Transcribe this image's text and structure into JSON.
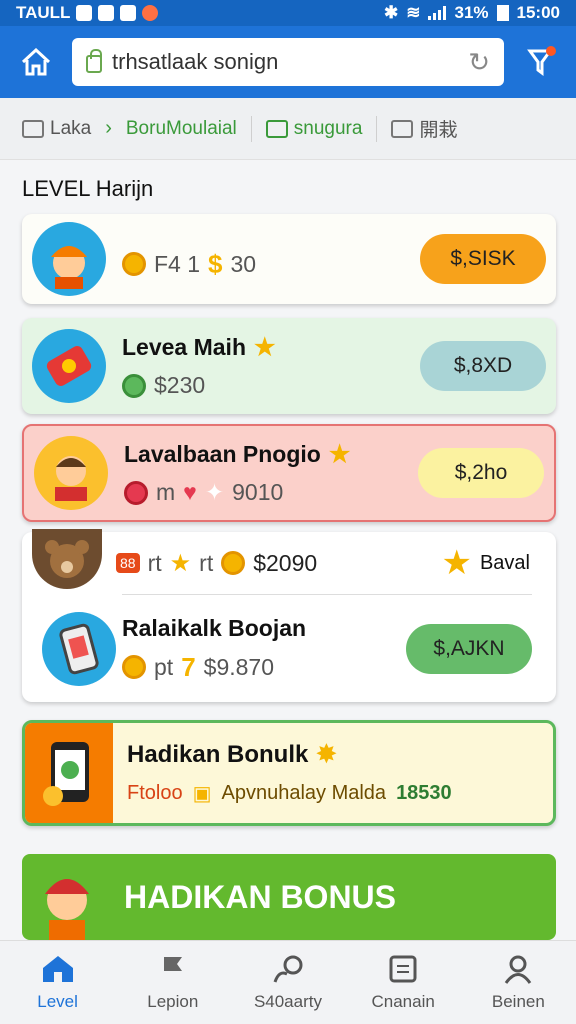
{
  "status_bar": {
    "carrier": "TAULL",
    "battery": "31%",
    "time": "15:00"
  },
  "browser": {
    "url": "trhsatlaak sonign"
  },
  "tabs": [
    {
      "label": "Laka"
    },
    {
      "label": "BoruMoulaial"
    },
    {
      "label": "snugura"
    },
    {
      "label": "開栽"
    }
  ],
  "page": {
    "heading": "LEVEL Harijn"
  },
  "cards": [
    {
      "title": "",
      "meta_prefix": "F4 1",
      "amount": "30",
      "button": "$,SISK"
    },
    {
      "title": "Levea Maih",
      "amount": "$230",
      "button": "$,8XD"
    },
    {
      "title": "Lavalbaan Pnogio",
      "meta_prefix": "m",
      "amount": "9010",
      "button": "$,2ho"
    }
  ],
  "combo_card": {
    "row1": {
      "badge": "88",
      "meta1": "rt",
      "meta2": "rt",
      "amount": "$2090",
      "bonus_label": "Baval"
    },
    "row2": {
      "title": "Ralaikalk Boojan",
      "meta_prefix": "pt",
      "digit": "7",
      "amount": "$9.870",
      "button": "$,AJKN"
    }
  },
  "promo": {
    "title": "Hadikan Bonulk",
    "text_a": "Ftoloo",
    "text_b": "Apvnuhalay Malda",
    "value": "18530"
  },
  "banner": {
    "label": "HADIKAN BONUS"
  },
  "bottom_nav": [
    {
      "label": "Level",
      "icon": "home-icon"
    },
    {
      "label": "Lepion",
      "icon": "flag-icon"
    },
    {
      "label": "S40aarty",
      "icon": "location-icon"
    },
    {
      "label": "Cnanain",
      "icon": "list-icon"
    },
    {
      "label": "Beinen",
      "icon": "user-icon"
    }
  ],
  "colors": {
    "primary": "#1e73d8",
    "orange_button": "#f7a21b",
    "teal_button": "#a9d4d6",
    "yellow_button": "#fbf2a0",
    "green_button": "#66bb6a",
    "banner_green": "#63b92e"
  }
}
